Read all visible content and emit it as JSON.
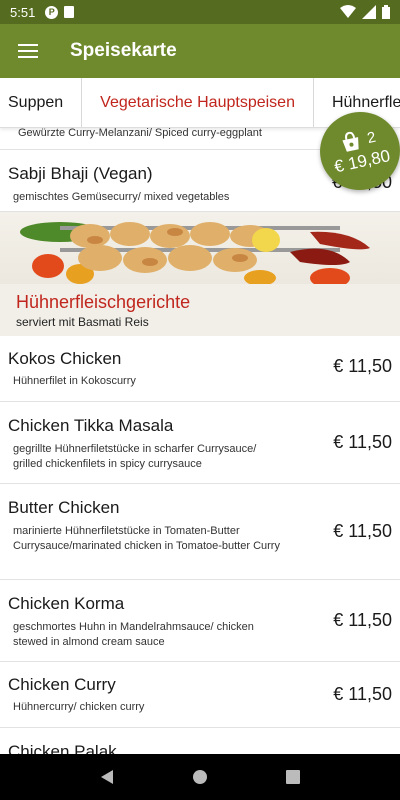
{
  "status_bar": {
    "time": "5:51",
    "notif_icon_letter": "P"
  },
  "app_bar": {
    "title": "Speisekarte"
  },
  "tabs": [
    {
      "label": "Suppen"
    },
    {
      "label": "Vegetarische Hauptspeisen"
    },
    {
      "label": "Hühnerfle"
    }
  ],
  "items_above": {
    "partial_desc": "Gewürzte Curry-Melanzani/ Spiced curry-eggplant",
    "sabji": {
      "name": "Sabji Bhaji (Vegan)",
      "desc": "gemischtes Gemüsecurry/ mixed vegetables",
      "price": "€ 10,50"
    }
  },
  "section": {
    "title": "Hühnerfleischgerichte",
    "subtitle": "serviert mit Basmati Reis"
  },
  "dishes": [
    {
      "name": "Kokos Chicken",
      "desc": "Hühnerfilet in Kokoscurry",
      "price": "€ 11,50"
    },
    {
      "name": "Chicken Tikka Masala",
      "desc": "gegrillte Hühnerfiletstücke in scharfer Currysauce/ grilled chickenfilets in spicy currysauce",
      "price": "€ 11,50"
    },
    {
      "name": "Butter Chicken",
      "desc": "marinierte Hühnerfiletstücke in Tomaten-Butter Currysauce/marinated chicken in Tomatoe-butter Curry",
      "price": "€ 11,50"
    },
    {
      "name": "Chicken Korma",
      "desc": "geschmortes Huhn in Mandelrahmsauce/ chicken stewed in almond cream sauce",
      "price": "€ 11,50"
    },
    {
      "name": "Chicken Curry",
      "desc": "Hühnercurry/ chicken curry",
      "price": "€ 11,50"
    },
    {
      "name": "Chicken Palak"
    }
  ],
  "cart": {
    "count": "2",
    "total": "€ 19,80"
  },
  "colors": {
    "primary": "#6f8a2c",
    "primary_dark": "#556b1f",
    "accent_red": "#c0261d"
  }
}
